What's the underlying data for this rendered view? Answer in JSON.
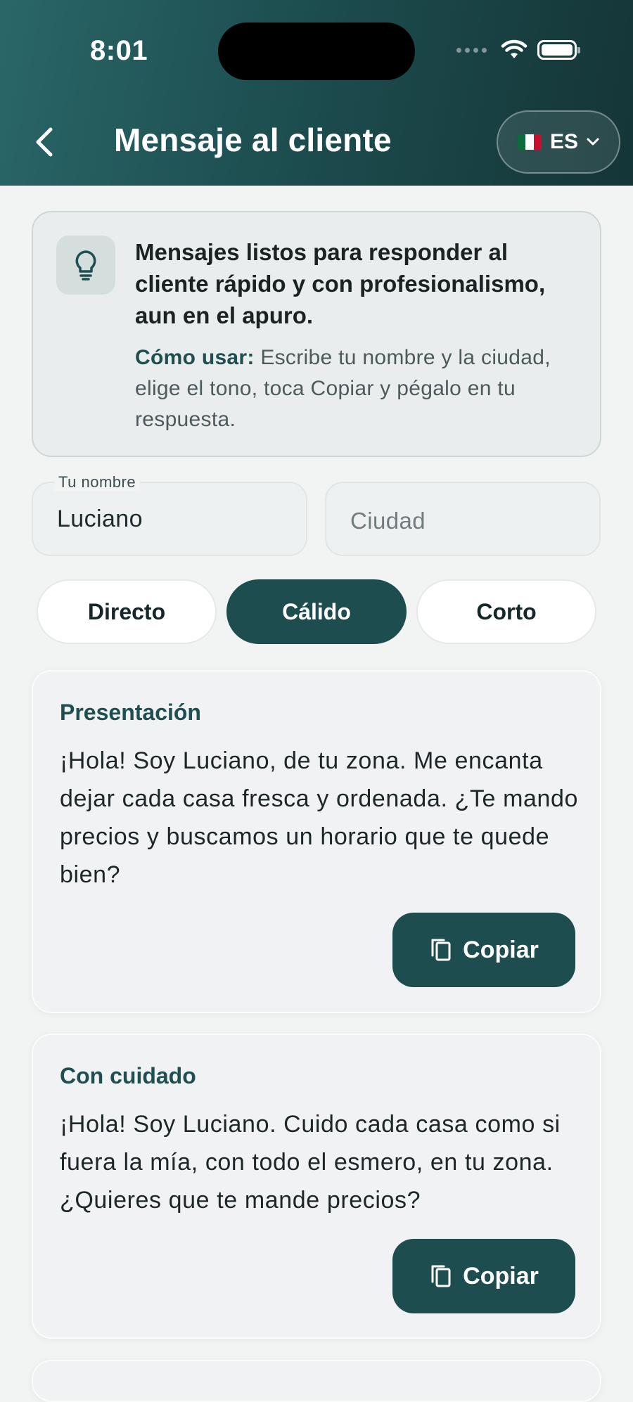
{
  "status_bar": {
    "time": "8:01"
  },
  "header": {
    "title": "Mensaje al cliente",
    "language": {
      "code": "ES",
      "flag_colors": [
        "#0b6b3a",
        "#ffffff",
        "#c8102e"
      ]
    }
  },
  "info": {
    "icon": "lightbulb-icon",
    "title": "Mensajes listos para responder al cliente rápido y con profesionalismo, aun en el apuro.",
    "how_label": "Cómo usar:",
    "how_text": " Escribe tu nombre y la ciudad, elige el tono, toca Copiar y pégalo en tu respuesta."
  },
  "form": {
    "name_label": "Tu nombre",
    "name_value": "Luciano",
    "city_placeholder": "Ciudad"
  },
  "tones": {
    "selected": "Cálido",
    "options": [
      "Directo",
      "Cálido",
      "Corto"
    ]
  },
  "messages": [
    {
      "heading": "Presentación",
      "text": "¡Hola! Soy Luciano, de tu zona. Me encanta dejar cada casa fresca y ordenada. ¿Te mando precios y buscamos un horario que te quede bien?",
      "copy_label": "Copiar"
    },
    {
      "heading": "Con cuidado",
      "text": "¡Hola! Soy Luciano. Cuido cada casa como si fuera la mía, con todo el esmero, en tu zona. ¿Quieres que te mande precios?",
      "copy_label": "Copiar"
    }
  ],
  "colors": {
    "primary": "#1e4d4f",
    "accent_text": "#1f4f50",
    "background": "#f2f4f4"
  }
}
